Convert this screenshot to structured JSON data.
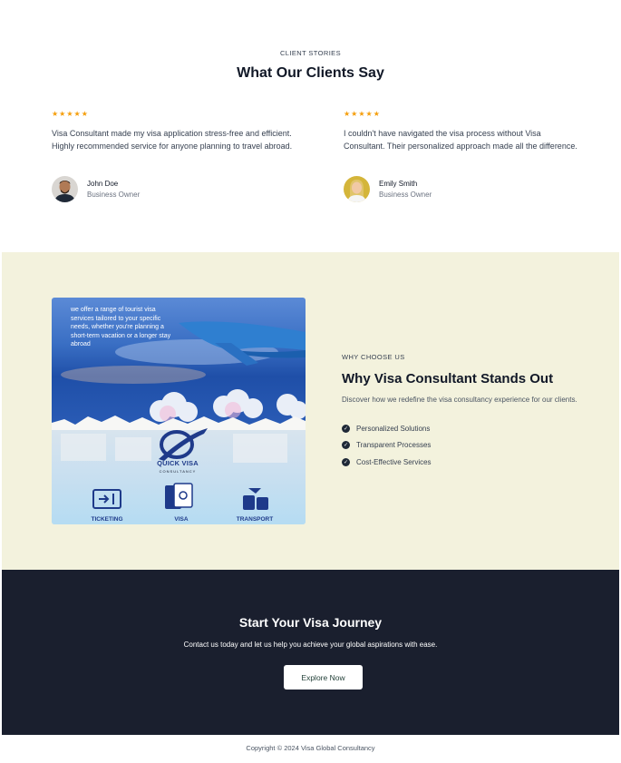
{
  "testimonials": {
    "eyebrow": "CLIENT STORIES",
    "title": "What Our Clients Say",
    "items": [
      {
        "stars": "★★★★★",
        "rating": 5,
        "quote": "Visa Consultant made my visa application stress-free and efficient. Highly recommended service for anyone planning to travel abroad.",
        "name": "John Doe",
        "role": "Business Owner"
      },
      {
        "stars": "★★★★★",
        "rating": 5,
        "quote": "I couldn't have navigated the visa process without Visa Consultant. Their personalized approach made all the difference.",
        "name": "Emily Smith",
        "role": "Business Owner"
      }
    ]
  },
  "why": {
    "promo": {
      "text": "we offer a range of tourist visa services tailored to your specific needs, whether you're planning a short-term vacation or a longer stay abroad",
      "brand": "QUICK VISA",
      "brand_sub": "CONSULTANCY",
      "services": [
        "TICKETING",
        "VISA",
        "TRANSPORT"
      ]
    },
    "eyebrow": "WHY CHOOSE US",
    "title": "Why Visa Consultant Stands Out",
    "description": "Discover how we redefine the visa consultancy experience for our clients.",
    "features": [
      "Personalized Solutions",
      "Transparent Processes",
      "Cost-Effective Services"
    ]
  },
  "cta": {
    "title": "Start Your Visa Journey",
    "description": "Contact us today and let us help you achieve your global aspirations with ease.",
    "button_label": "Explore Now"
  },
  "footer": {
    "copyright": "Copyright © 2024 Visa Global Consultancy"
  },
  "colors": {
    "star": "#f59e0b",
    "why_background": "#f3f2dd",
    "cta_background": "#1a1f2e",
    "brand_blue": "#1e3a8a"
  }
}
